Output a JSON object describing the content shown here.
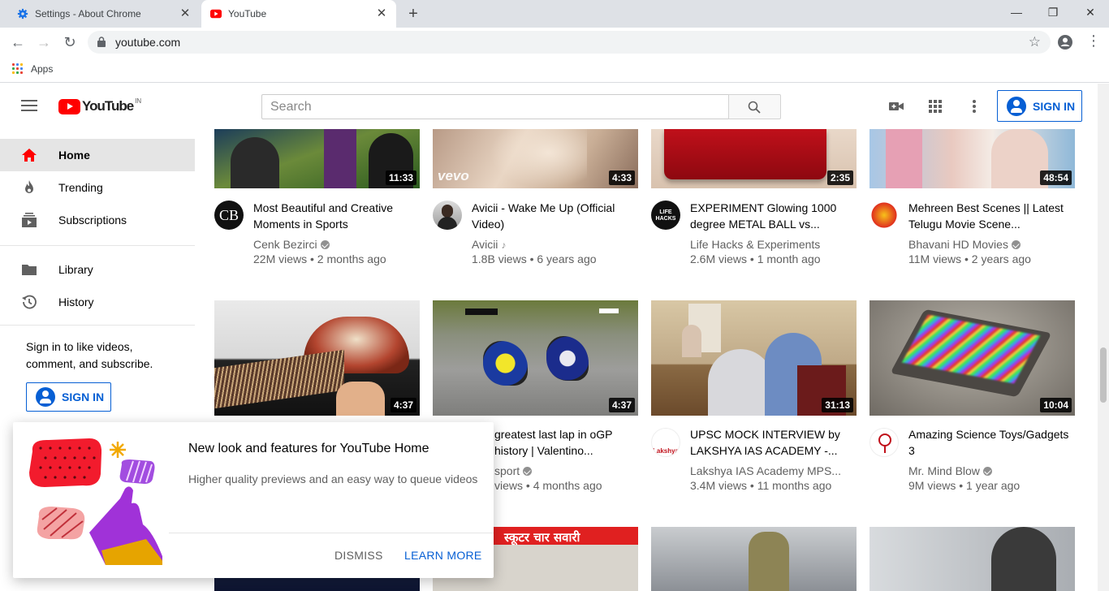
{
  "browser": {
    "tabs": [
      {
        "title": "Settings - About Chrome"
      },
      {
        "title": "YouTube"
      }
    ],
    "url": "youtube.com",
    "bookmarks_label": "Apps"
  },
  "header": {
    "logo_text": "YouTube",
    "region": "IN",
    "search_placeholder": "Search",
    "signin_label": "SIGN IN"
  },
  "sidebar": {
    "items": [
      {
        "label": "Home"
      },
      {
        "label": "Trending"
      },
      {
        "label": "Subscriptions"
      },
      {
        "label": "Library"
      },
      {
        "label": "History"
      }
    ],
    "signin_prompt": "Sign in to like videos, comment, and subscribe.",
    "signin_label": "SIGN IN"
  },
  "videos": [
    {
      "duration": "11:33",
      "title": "Most Beautiful and Creative Moments in Sports",
      "channel": "Cenk Bezirci",
      "meta": "22M views • 2 months ago",
      "avatar": "CB"
    },
    {
      "duration": "4:33",
      "title": "Avicii - Wake Me Up (Official Video)",
      "channel": "Avicii",
      "meta": "1.8B views • 6 years ago",
      "watermark": "vevo"
    },
    {
      "duration": "2:35",
      "title": "EXPERIMENT Glowing 1000 degree METAL BALL vs...",
      "channel": "Life Hacks & Experiments",
      "meta": "2.6M views • 1 month ago",
      "avatar": "LIFE HACKS"
    },
    {
      "duration": "48:54",
      "title": "Mehreen Best Scenes || Latest Telugu Movie Scene...",
      "channel": "Bhavani HD Movies",
      "meta": "11M views • 2 years ago"
    },
    {
      "duration": "4:37",
      "title": "",
      "channel": "",
      "meta": ""
    },
    {
      "duration": "4:37",
      "title": "greatest last lap in oGP history | Valentino...",
      "channel": "sport",
      "meta": "views • 4 months ago"
    },
    {
      "duration": "31:13",
      "title": "UPSC MOCK INTERVIEW by LAKSHYA IAS ACADEMY -...",
      "channel": "Lakshya IAS Academy MPS...",
      "meta": "3.4M views • 11 months ago",
      "avatar": "Lakshya"
    },
    {
      "duration": "10:04",
      "title": "Amazing Science Toys/Gadgets 3",
      "channel": "Mr. Mind Blow",
      "meta": "9M views • 1 year ago"
    }
  ],
  "row3_banner_text": "स्कूटर चार सवारी",
  "popup": {
    "title": "New look and features for YouTube Home",
    "description": "Higher quality previews and an easy way to queue videos",
    "dismiss_label": "DISMISS",
    "learn_more_label": "LEARN MORE"
  },
  "colors": {
    "brand_red": "#ff0000",
    "link_blue": "#065fd4",
    "secondary_text": "#606060"
  }
}
